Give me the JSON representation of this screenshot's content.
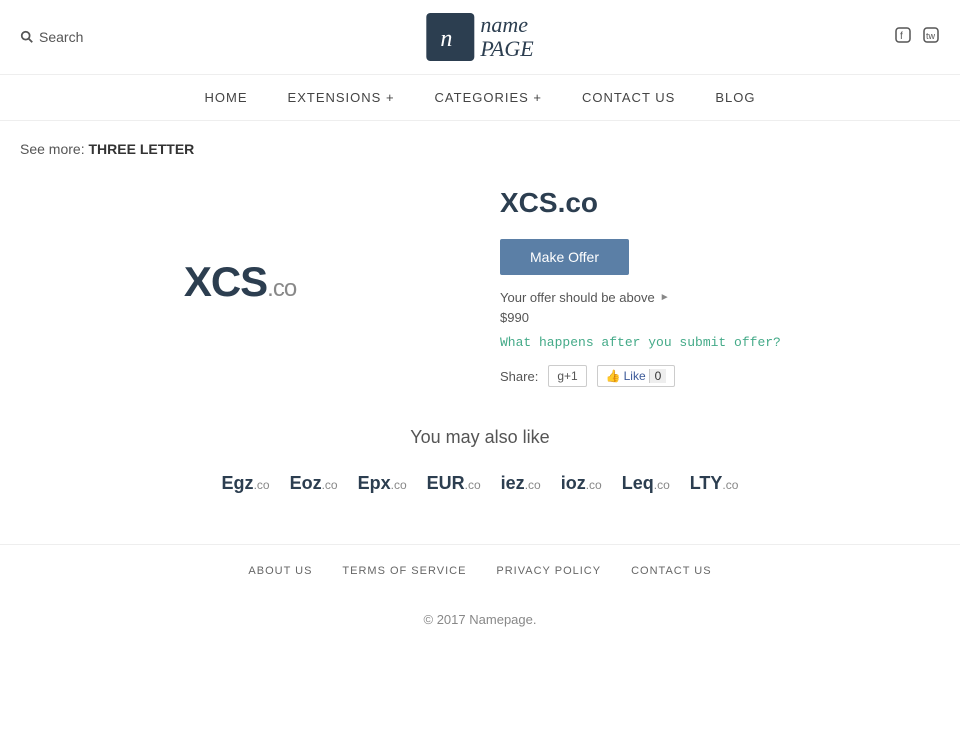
{
  "header": {
    "search_label": "Search",
    "logo_icon_char": "n",
    "logo_name": "name",
    "logo_page": "PAGE",
    "social": {
      "facebook": "f",
      "twitter": "t"
    }
  },
  "nav": {
    "items": [
      {
        "label": "HOME",
        "id": "home"
      },
      {
        "label": "EXTENSIONS +",
        "id": "extensions"
      },
      {
        "label": "CATEGORIES +",
        "id": "categories"
      },
      {
        "label": "CONTACT US",
        "id": "contact"
      },
      {
        "label": "BLOG",
        "id": "blog"
      }
    ]
  },
  "breadcrumb": {
    "prefix": "See more:",
    "link_text": "THREE LETTER"
  },
  "domain": {
    "name": "XCS",
    "ext": ".co",
    "full": "XCS.co",
    "make_offer_label": "Make Offer",
    "offer_hint": "Your offer should be above",
    "offer_price": "$990",
    "what_happens_link": "What happens after you submit offer?",
    "share_label": "Share:",
    "gplus_label": "g+1",
    "fb_label": "Like",
    "fb_count": "0"
  },
  "also_like": {
    "title": "You may also like",
    "domains": [
      {
        "name": "Egz",
        "ext": ".co"
      },
      {
        "name": "Eoz",
        "ext": ".co"
      },
      {
        "name": "Epx",
        "ext": ".co"
      },
      {
        "name": "EUR",
        "ext": ".co"
      },
      {
        "name": "iez",
        "ext": ".co"
      },
      {
        "name": "ioz",
        "ext": ".co"
      },
      {
        "name": "Leq",
        "ext": ".co"
      },
      {
        "name": "LTY",
        "ext": ".co"
      }
    ]
  },
  "footer": {
    "links": [
      {
        "label": "ABOUT US",
        "id": "about"
      },
      {
        "label": "TERMS OF SERVICE",
        "id": "terms"
      },
      {
        "label": "PRIVACY POLICY",
        "id": "privacy"
      },
      {
        "label": "CONTACT US",
        "id": "contact"
      }
    ],
    "copyright": "© 2017",
    "brand": "Namepage."
  }
}
